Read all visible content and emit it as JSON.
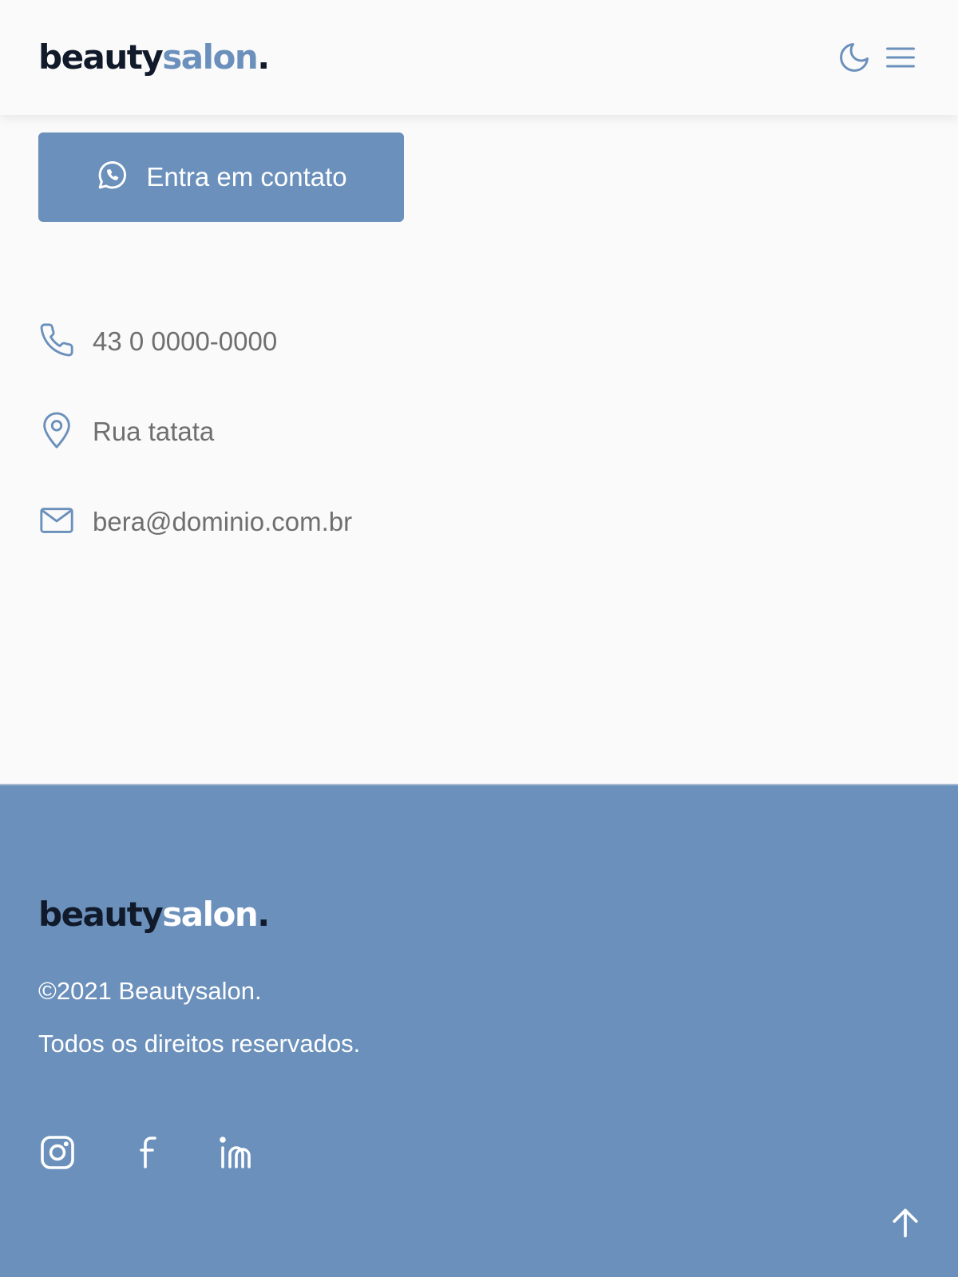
{
  "header": {
    "logo": {
      "part1": "beauty",
      "part2": "salon",
      "part3": "."
    },
    "icons": {
      "theme_toggle": "moon-icon",
      "menu": "hamburger-menu-icon"
    }
  },
  "contact_button": {
    "label": "Entra em contato",
    "icon": "whatsapp-icon"
  },
  "contact_info": {
    "phone": "43 0 0000-0000",
    "address": "Rua tatata",
    "email": "bera@dominio.com.br"
  },
  "footer": {
    "logo": {
      "part1": "beauty",
      "part2": "salon",
      "part3": "."
    },
    "copyright": "©2021 Beautysalon.",
    "rights": "Todos os direitos reservados.",
    "social": [
      "instagram-icon",
      "facebook-icon",
      "linkedin-icon"
    ],
    "back_to_top_icon": "arrow-up-icon"
  },
  "colors": {
    "accent": "#6a90bb",
    "dark": "#111a2b",
    "text_muted": "#6f6f6f",
    "background": "#fafafa",
    "white": "#ffffff"
  }
}
